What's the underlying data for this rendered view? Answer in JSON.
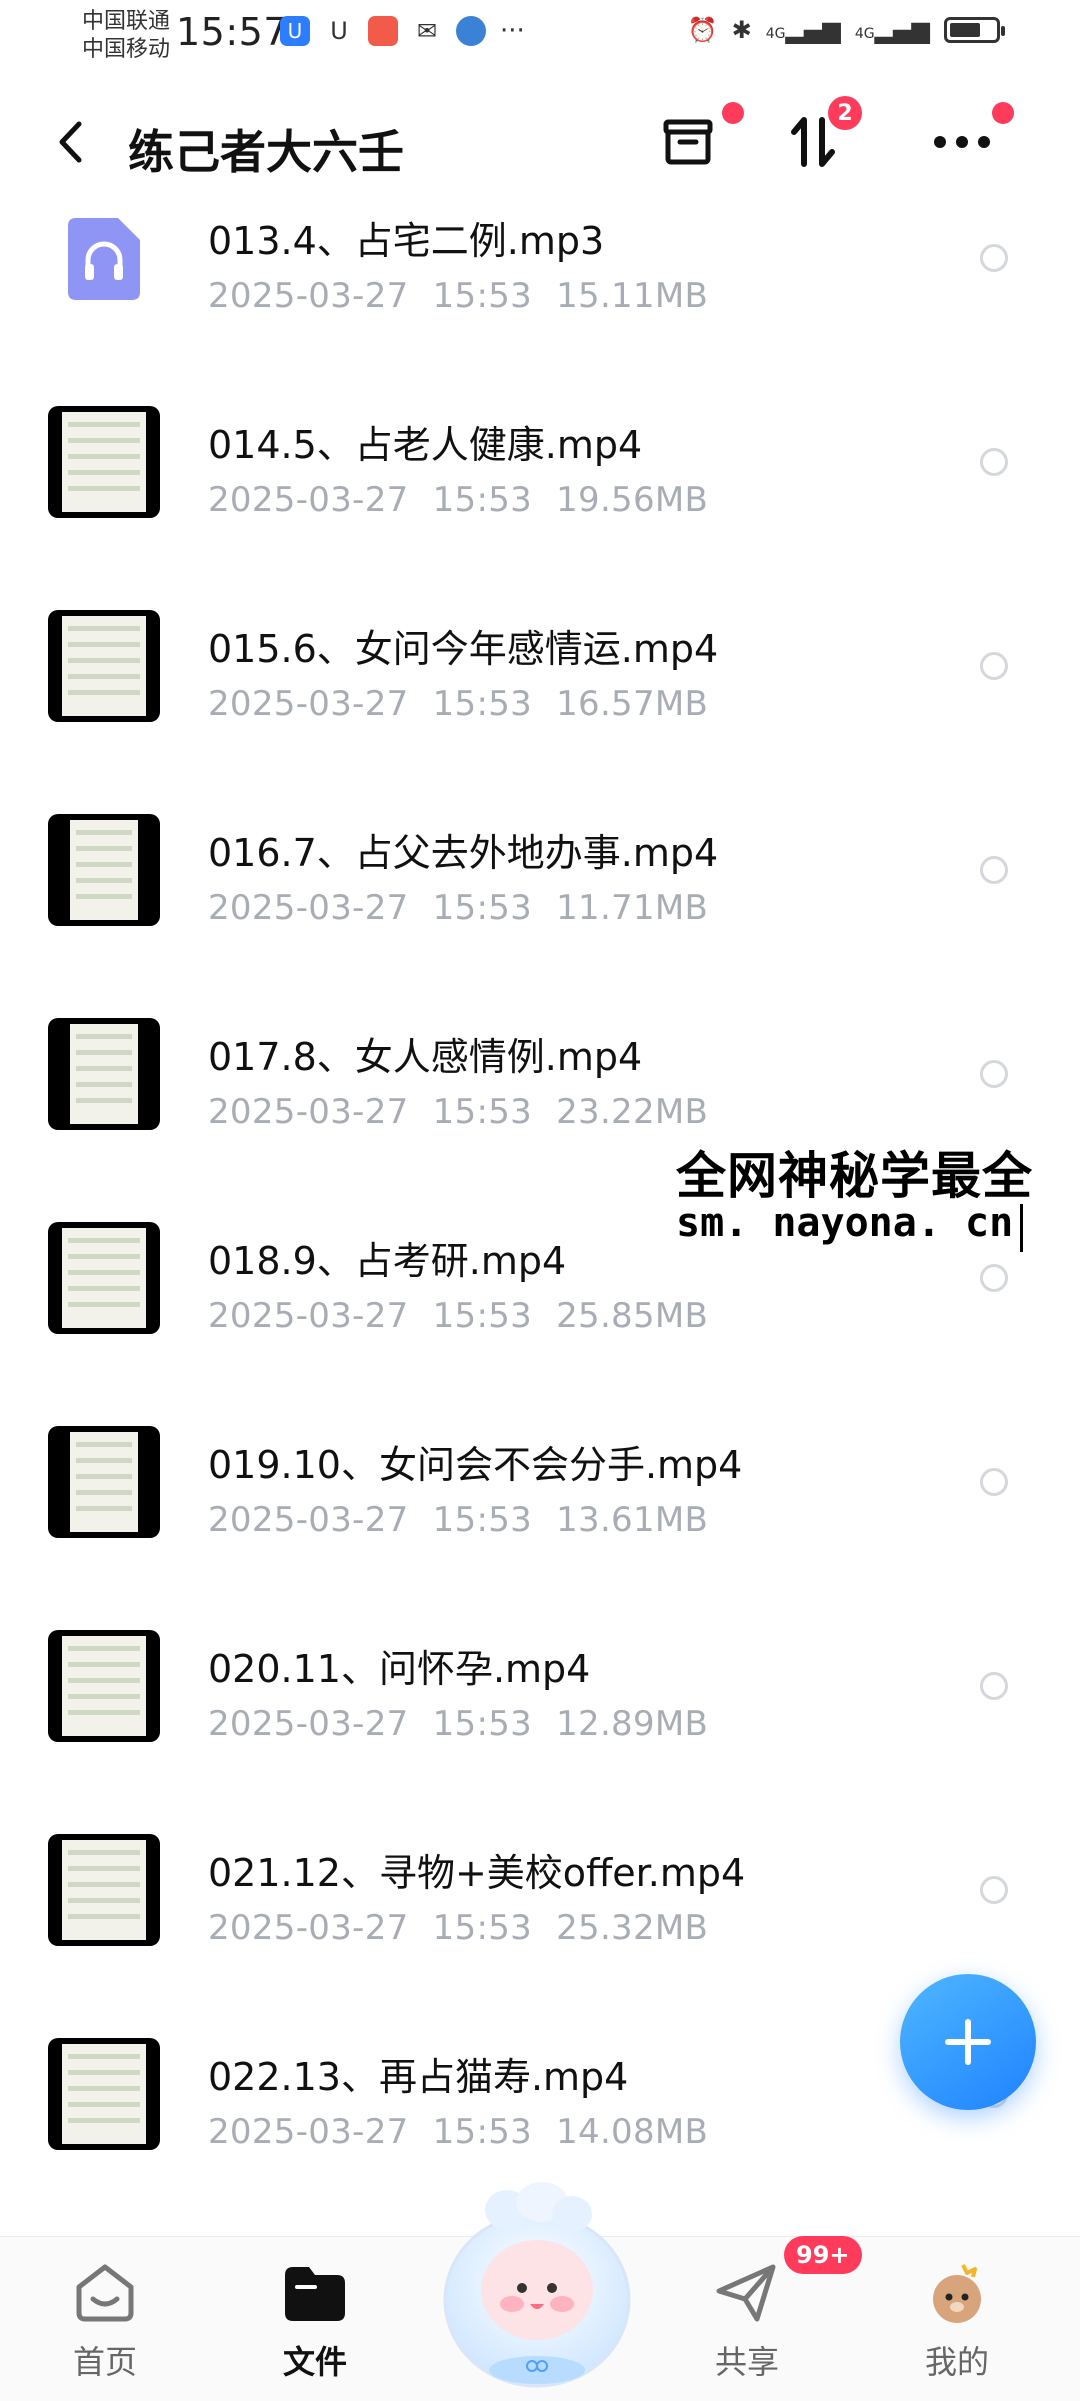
{
  "status_bar": {
    "carrier1": "中国联通",
    "carrier2": "中国移动",
    "time": "15:57",
    "network1": "4G",
    "network2": "4G",
    "colors": {
      "blue_app": "#2d7dff",
      "red_app": "#f25b4a",
      "green_app": "#3aa56e"
    }
  },
  "header": {
    "title": "练己者大六壬",
    "sort_badge": "2"
  },
  "files": [
    {
      "name": "013.4、占宅二例.mp3",
      "date": "2025-03-27",
      "time": "15:53",
      "size": "15.11MB",
      "type": "audio"
    },
    {
      "name": "014.5、占老人健康.mp4",
      "date": "2025-03-27",
      "time": "15:53",
      "size": "19.56MB",
      "type": "video"
    },
    {
      "name": "015.6、女问今年感情运.mp4",
      "date": "2025-03-27",
      "time": "15:53",
      "size": "16.57MB",
      "type": "video"
    },
    {
      "name": "016.7、占父去外地办事.mp4",
      "date": "2025-03-27",
      "time": "15:53",
      "size": "11.71MB",
      "type": "video"
    },
    {
      "name": "017.8、女人感情例.mp4",
      "date": "2025-03-27",
      "time": "15:53",
      "size": "23.22MB",
      "type": "video"
    },
    {
      "name": "018.9、占考研.mp4",
      "date": "2025-03-27",
      "time": "15:53",
      "size": "25.85MB",
      "type": "video"
    },
    {
      "name": "019.10、女问会不会分手.mp4",
      "date": "2025-03-27",
      "time": "15:53",
      "size": "13.61MB",
      "type": "video"
    },
    {
      "name": "020.11、问怀孕.mp4",
      "date": "2025-03-27",
      "time": "15:53",
      "size": "12.89MB",
      "type": "video"
    },
    {
      "name": "021.12、寻物+美校offer.mp4",
      "date": "2025-03-27",
      "time": "15:53",
      "size": "25.32MB",
      "type": "video"
    },
    {
      "name": "022.13、再占猫寿.mp4",
      "date": "2025-03-27",
      "time": "15:53",
      "size": "14.08MB",
      "type": "video"
    }
  ],
  "watermark": {
    "line1": "全网神秘学最全",
    "line2": "sm. nayona. cn"
  },
  "bottom_nav": {
    "home": "首页",
    "files": "文件",
    "share": "共享",
    "mine": "我的",
    "share_badge": "99+"
  },
  "accent": "#1f82ff"
}
